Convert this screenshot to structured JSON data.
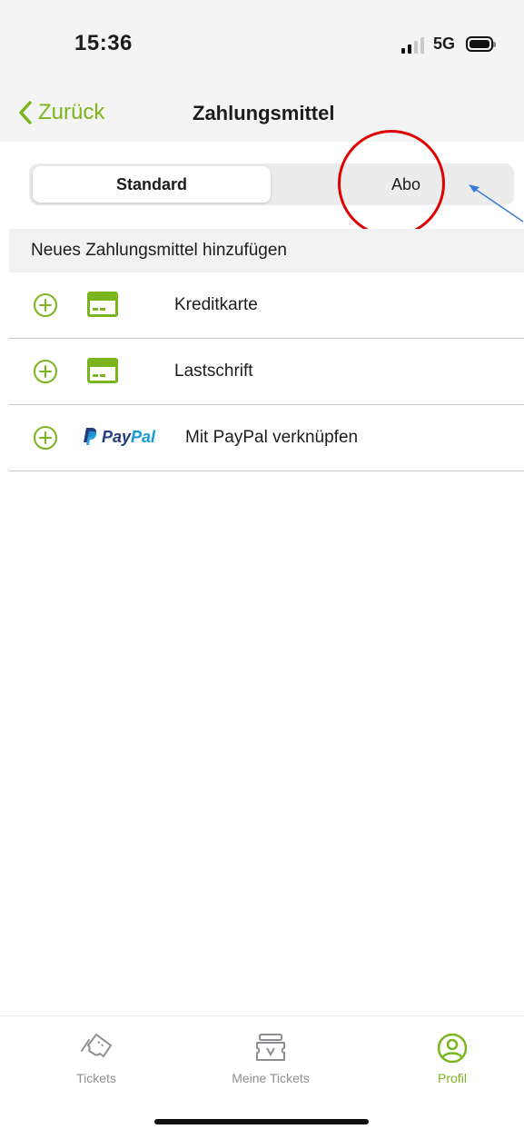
{
  "status": {
    "time": "15:36",
    "network": "5G"
  },
  "nav": {
    "back_label": "Zurück",
    "title": "Zahlungsmittel"
  },
  "segment": {
    "options": [
      "Standard",
      "Abo"
    ],
    "selected": "Standard"
  },
  "section": {
    "header": "Neues Zahlungsmittel hinzufügen"
  },
  "payment_methods": [
    {
      "label": "Kreditkarte",
      "icon": "credit-card-icon"
    },
    {
      "label": "Lastschrift",
      "icon": "credit-card-icon"
    },
    {
      "label": "Mit PayPal verknüpfen",
      "icon": "paypal-logo",
      "logo_text": {
        "pay": "Pay",
        "pal": "Pal"
      }
    }
  ],
  "tabs": [
    {
      "label": "Tickets",
      "icon": "ticket-icon",
      "active": false
    },
    {
      "label": "Meine Tickets",
      "icon": "my-tickets-icon",
      "active": false
    },
    {
      "label": "Profil",
      "icon": "profile-icon",
      "active": true
    }
  ],
  "colors": {
    "accent": "#7ab51d",
    "annotation_circle": "#e00000",
    "annotation_arrow": "#3a7bd5",
    "paypal_dark": "#253b80",
    "paypal_light": "#179bd7"
  }
}
